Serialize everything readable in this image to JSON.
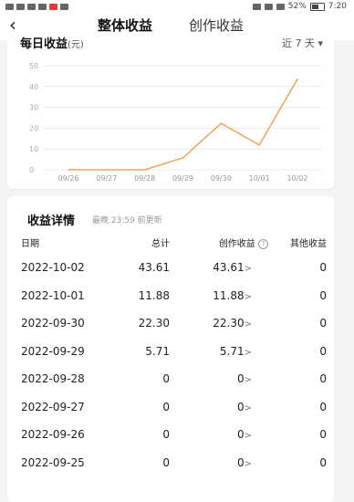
{
  "status_bar": {
    "battery": "52%",
    "time": "7:20"
  },
  "nav": {
    "back_icon": "chevron-left-icon",
    "tabs": [
      {
        "label": "整体收益",
        "active": true
      },
      {
        "label": "创作收益",
        "active": false
      }
    ],
    "accent_color": "#f0583c"
  },
  "chart_section": {
    "title": "每日收益",
    "unit": "(元)",
    "period": "近 7 天",
    "period_icon": "caret-down-icon"
  },
  "chart_data": {
    "type": "line",
    "categories": [
      "09/26",
      "09/27",
      "09/28",
      "09/29",
      "09/30",
      "10/01",
      "10/02"
    ],
    "values": [
      0,
      0,
      0,
      5.71,
      22.3,
      11.88,
      43.61
    ],
    "yticks": [
      0,
      10,
      20,
      30,
      40,
      50
    ],
    "ylim": [
      0,
      50
    ],
    "grid": true,
    "line_color": "#f5a25a"
  },
  "detail": {
    "title": "收益详情",
    "note": "最晚 23:59 前更新",
    "columns": {
      "date": "日期",
      "total": "总计",
      "creation": "创作收益",
      "other": "其他收益"
    },
    "help_icon": "question-circle-icon",
    "row_arrow": ">",
    "rows": [
      {
        "date": "2022-10-02",
        "total": "43.61",
        "creation": "43.61",
        "other": "0"
      },
      {
        "date": "2022-10-01",
        "total": "11.88",
        "creation": "11.88",
        "other": "0"
      },
      {
        "date": "2022-09-30",
        "total": "22.30",
        "creation": "22.30",
        "other": "0"
      },
      {
        "date": "2022-09-29",
        "total": "5.71",
        "creation": "5.71",
        "other": "0"
      },
      {
        "date": "2022-09-28",
        "total": "0",
        "creation": "0",
        "other": "0"
      },
      {
        "date": "2022-09-27",
        "total": "0",
        "creation": "0",
        "other": "0"
      },
      {
        "date": "2022-09-26",
        "total": "0",
        "creation": "0",
        "other": "0"
      },
      {
        "date": "2022-09-25",
        "total": "0",
        "creation": "0",
        "other": "0"
      }
    ]
  }
}
